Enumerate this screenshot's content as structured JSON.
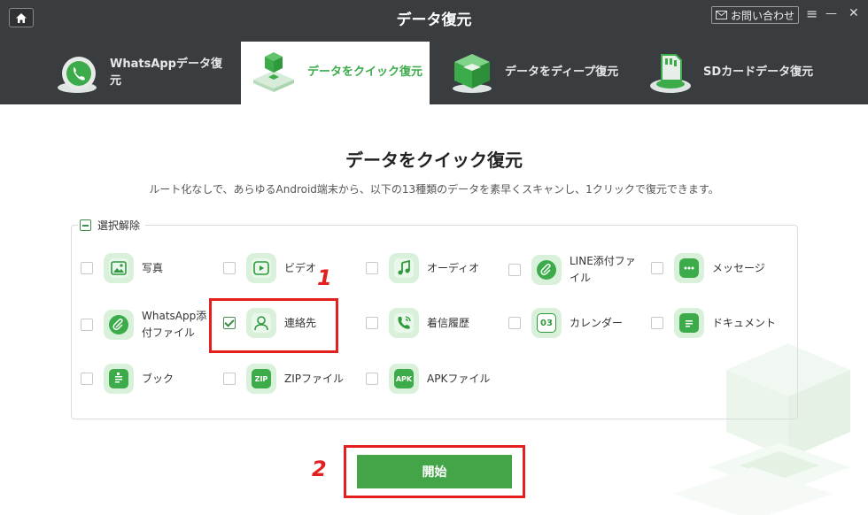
{
  "window": {
    "title": "データ復元",
    "contact_label": "お問い合わせ",
    "menu_glyph": "≡",
    "minimize_glyph": "—",
    "close_glyph": "✕"
  },
  "tabs": [
    {
      "label_line1": "WhatsAppデータ復",
      "label_line2": "元",
      "icon": "whatsapp-phone-icon",
      "active": false
    },
    {
      "label_line1": "データをクイック復元",
      "label_line2": "",
      "icon": "quick-restore-cube-icon",
      "active": true
    },
    {
      "label_line1": "データをディープ復元",
      "label_line2": "",
      "icon": "deep-restore-cube-icon",
      "active": false
    },
    {
      "label_line1": "SDカードデータ復元",
      "label_line2": "",
      "icon": "sd-card-icon",
      "active": false
    }
  ],
  "main": {
    "title": "データをクイック復元",
    "subtitle": "ルート化なしで、あらゆるAndroid端末から、以下の13種類のデータを素早くスキャンし、1クリックで復元できます。",
    "select_all_label": "選択解除",
    "start_label": "開始"
  },
  "items": [
    {
      "label1": "写真",
      "label2": "",
      "checked": false,
      "icon": "photo-icon"
    },
    {
      "label1": "ビデオ",
      "label2": "",
      "checked": false,
      "icon": "video-icon"
    },
    {
      "label1": "オーディオ",
      "label2": "",
      "checked": false,
      "icon": "audio-icon"
    },
    {
      "label1": "LINE添付ファ",
      "label2": "イル",
      "checked": false,
      "icon": "line-attachment-icon"
    },
    {
      "label1": "メッセージ",
      "label2": "",
      "checked": false,
      "icon": "message-icon"
    },
    {
      "label1": "WhatsApp添",
      "label2": "付ファイル",
      "checked": false,
      "icon": "whatsapp-attachment-icon"
    },
    {
      "label1": "連絡先",
      "label2": "",
      "checked": true,
      "icon": "contacts-icon"
    },
    {
      "label1": "着信履歴",
      "label2": "",
      "checked": false,
      "icon": "call-history-icon"
    },
    {
      "label1": "カレンダー",
      "label2": "",
      "checked": false,
      "icon": "calendar-icon"
    },
    {
      "label1": "ドキュメント",
      "label2": "",
      "checked": false,
      "icon": "document-icon"
    },
    {
      "label1": "ブック",
      "label2": "",
      "checked": false,
      "icon": "book-icon"
    },
    {
      "label1": "ZIPファイル",
      "label2": "",
      "checked": false,
      "icon": "zip-file-icon"
    },
    {
      "label1": "APKファイル",
      "label2": "",
      "checked": false,
      "icon": "apk-file-icon"
    }
  ],
  "calendar_icon_text": "03",
  "zip_icon_text": "ZIP",
  "apk_icon_text": "APK",
  "annotations": {
    "marker1": "1",
    "marker2": "2",
    "color": "#e3201f"
  },
  "colors": {
    "accent": "#43a548",
    "topbar": "#3a3d3f"
  }
}
